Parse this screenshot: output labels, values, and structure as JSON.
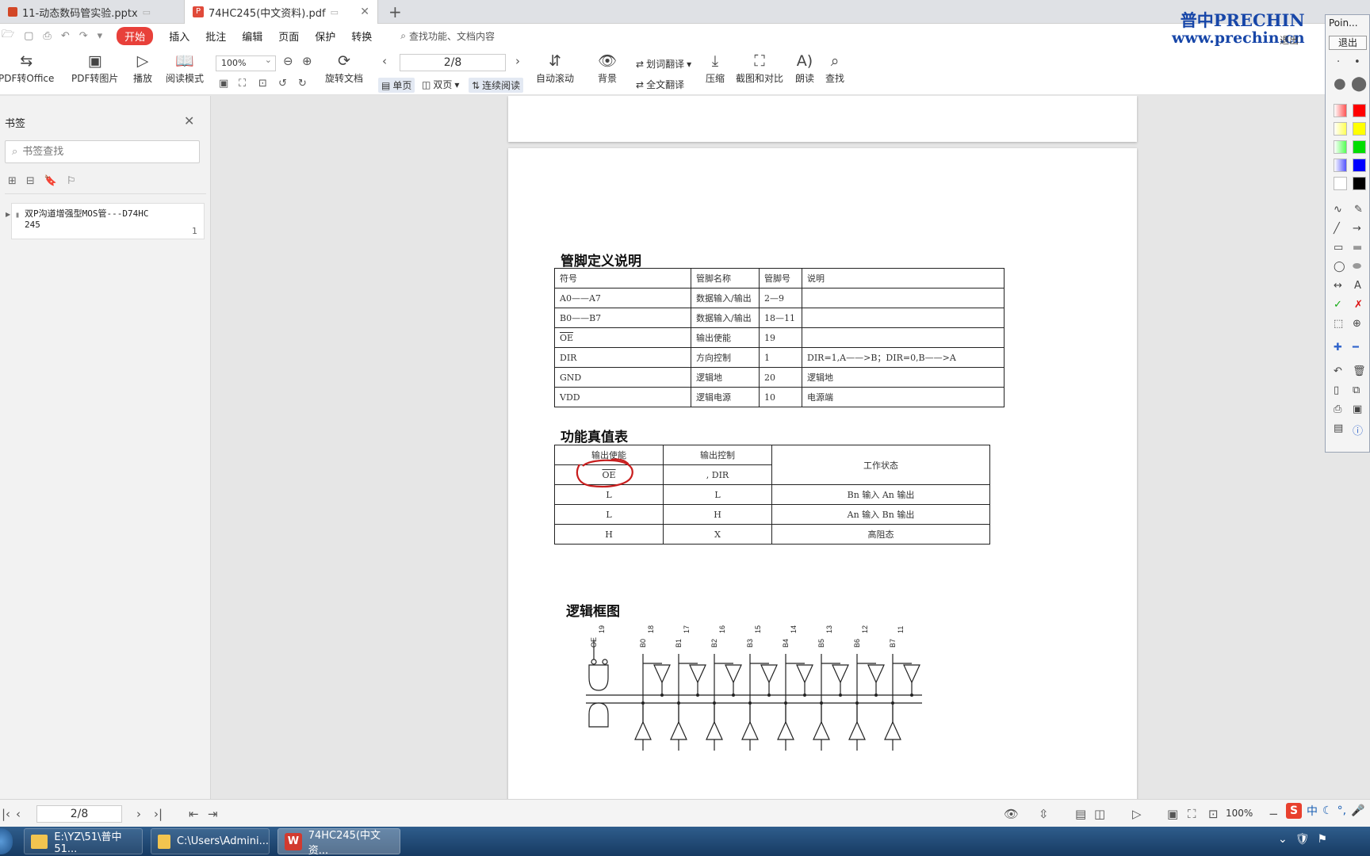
{
  "tabs": [
    {
      "label": "11-动态数码管实验.pptx",
      "active": false
    },
    {
      "label": "74HC245(中文资料).pdf",
      "active": true
    }
  ],
  "menu": {
    "items": [
      "开始",
      "插入",
      "批注",
      "编辑",
      "页面",
      "保护",
      "转换"
    ],
    "search_placeholder": "查找功能、文档内容"
  },
  "toolbar": {
    "pdf_to_office": "PDF转Office",
    "pdf_to_image": "PDF转图片",
    "play": "播放",
    "read_mode": "阅读模式",
    "zoom": "100%",
    "rotate": "旋转文档",
    "page_indicator": "2/8",
    "single_page": "单页",
    "double_page": "双页",
    "continuous": "连续阅读",
    "auto_scroll": "自动滚动",
    "background": "背景",
    "word_translate": "划词翻译",
    "full_translate": "全文翻译",
    "compress": "压缩",
    "screenshot_compare": "截图和对比",
    "read_aloud": "朗读",
    "find": "查找"
  },
  "watermark": {
    "line1": "普中PRECHIN",
    "line2": "www.prechin.cn",
    "extra": "退出"
  },
  "sidebar": {
    "title": "书签",
    "search_placeholder": "书签查找",
    "bookmark": {
      "line1": "双P沟道增强型MOS管---D74HC",
      "line2": "245",
      "page": "1"
    }
  },
  "document": {
    "pin_title": "管脚定义说明",
    "pin_table": {
      "headers": [
        "符号",
        "管脚名称",
        "管脚号",
        "说明"
      ],
      "rows": [
        [
          "A0——A7",
          "数据输入/输出",
          "2—9",
          ""
        ],
        [
          "B0——B7",
          "数据输入/输出",
          "18—11",
          ""
        ],
        [
          "OE",
          "输出使能",
          "19",
          ""
        ],
        [
          "DIR",
          "方向控制",
          "1",
          "DIR=1,A——>B；DIR=0,B——>A"
        ],
        [
          "GND",
          "逻辑地",
          "20",
          "逻辑地"
        ],
        [
          "VDD",
          "逻辑电源",
          "10",
          "电源端"
        ]
      ]
    },
    "truth_title": "功能真值表",
    "truth_table": {
      "headers": [
        "输出使能",
        "输出控制",
        "工作状态"
      ],
      "subheaders": [
        "OE",
        ", DIR"
      ],
      "rows": [
        [
          "L",
          "L",
          "Bn 输入 An  输出"
        ],
        [
          "L",
          "H",
          "An 输入 Bn  输出"
        ],
        [
          "H",
          "X",
          "高阻态"
        ]
      ]
    },
    "logic_title": "逻辑框图",
    "logic_diagram": {
      "pin_labels": [
        "OE",
        "B0",
        "B1",
        "B2",
        "B3",
        "B4",
        "B5",
        "B6",
        "B7"
      ],
      "pin_numbers": [
        "19",
        "18",
        "17",
        "16",
        "15",
        "14",
        "13",
        "12",
        "11"
      ]
    }
  },
  "pointer_tool": {
    "title": "Poin...",
    "exit": "退出"
  },
  "statusbar": {
    "page": "2/8",
    "zoom": "100%"
  },
  "taskbar": [
    {
      "label": "E:\\YZ\\51\\普中51...",
      "icon": "folder-icon"
    },
    {
      "label": "C:\\Users\\Admini...",
      "icon": "folder-icon"
    },
    {
      "label": "74HC245(中文资...",
      "icon": "wps-icon"
    }
  ],
  "ime": {
    "label": "中"
  }
}
